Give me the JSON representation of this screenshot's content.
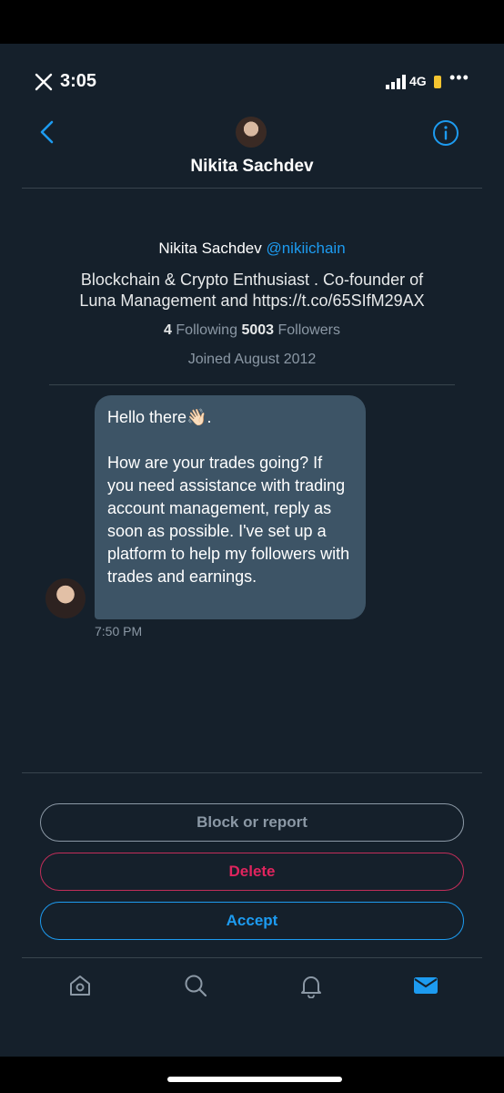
{
  "status": {
    "time": "3:05",
    "network": "4G",
    "more": "•••"
  },
  "header": {
    "title": "Nikita Sachdev"
  },
  "profile": {
    "name": "Nikita Sachdev",
    "handle": "@nikiichain",
    "bio_line1": "Blockchain & Crypto Enthusiast . Co-founder of",
    "bio_line2": "Luna Management and https://t.co/65SIfM29AX",
    "following_count": "4",
    "following_label": "Following",
    "followers_count": "5003",
    "followers_label": "Followers",
    "joined": "Joined August 2012"
  },
  "message": {
    "greeting": "Hello there👋🏻.",
    "body": "How are your trades going? If you need assistance with trading account management, reply as soon as possible. I've set up a platform to help my followers with trades and earnings.",
    "time": "7:50 PM"
  },
  "actions": {
    "block": "Block or report",
    "delete": "Delete",
    "accept": "Accept"
  },
  "colors": {
    "background": "#15202b",
    "accent": "#1d9bf0",
    "danger": "#e0245e",
    "bubble": "#3d5466"
  },
  "tabs": [
    "home-icon",
    "search-icon",
    "notifications-icon",
    "messages-icon"
  ]
}
